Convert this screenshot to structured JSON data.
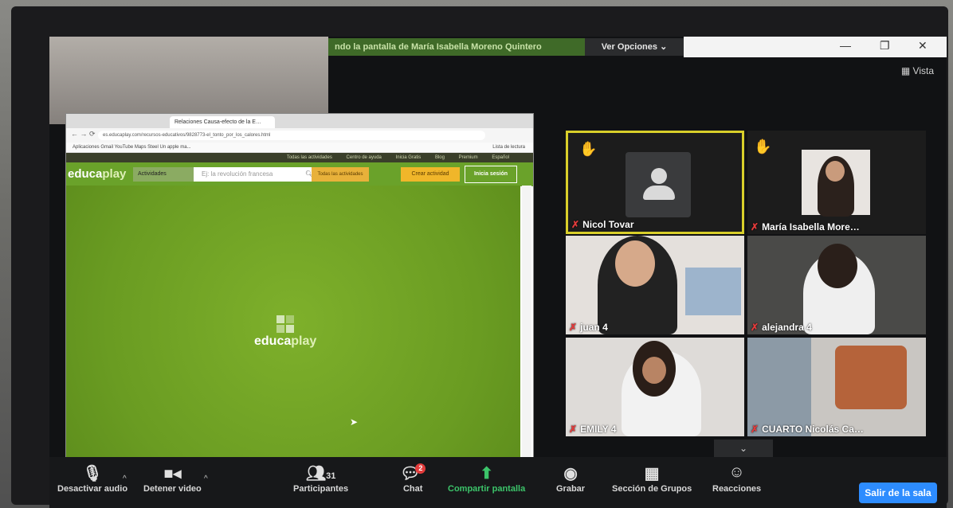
{
  "share_bar": {
    "text": "ndo la pantalla de María Isabella Moreno Quintero"
  },
  "view_options": {
    "label": "Ver Opciones ⌄"
  },
  "view_button": {
    "label": "Vista"
  },
  "browser": {
    "tabs": [
      "",
      "Relaciones Causa-efecto de la E…"
    ],
    "url": "es.educaplay.com/recursos-educativos/9828773-el_tonto_por_los_calores.html",
    "bookmarks": "Aplicaciones   Gmail   YouTube   Maps   Steel   Un apple ma...",
    "reading_list": "Lista de lectura",
    "top_links": [
      "Todas las actividades",
      "Centro de ayuda",
      "Inicia Gratis",
      "Blog",
      "Premium",
      "Español"
    ],
    "logo": {
      "a": "educa",
      "b": "play"
    },
    "actividades": "Actividades",
    "search_placeholder": "Ej: la revolución francesa",
    "todas": "Todas las actividades",
    "crear": "Crear actividad",
    "inicia": "Inicia sesión",
    "center_logo": {
      "a": "educa",
      "b": "play"
    }
  },
  "participants": [
    {
      "name": "Nicol Tovar",
      "raised_hand": true,
      "active_speaker": true,
      "video": false
    },
    {
      "name": "María Isabella More…",
      "raised_hand": true,
      "video": true
    },
    {
      "name": "juan 4",
      "video": true
    },
    {
      "name": "alejandra 4",
      "video": true
    },
    {
      "name": "EMILY 4",
      "video": true
    },
    {
      "name": "CUARTO Nicolás Ca…",
      "video": true
    }
  ],
  "toolbar": {
    "audio": "Desactivar audio",
    "video": "Detener video",
    "participants": "Participantes",
    "participants_count": "31",
    "chat": "Chat",
    "chat_badge": "2",
    "share": "Compartir pantalla",
    "record": "Grabar",
    "groups": "Sección de Grupos",
    "reactions": "Reacciones",
    "leave": "Salir de la sala"
  }
}
